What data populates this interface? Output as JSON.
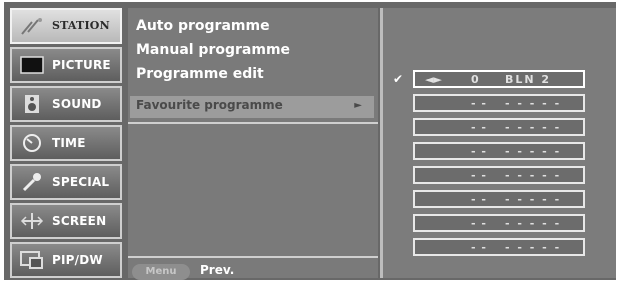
{
  "menu": {
    "items": [
      {
        "label": "STATION",
        "icon": "station-icon",
        "active": true
      },
      {
        "label": "PICTURE",
        "icon": "picture-icon"
      },
      {
        "label": "SOUND",
        "icon": "sound-icon"
      },
      {
        "label": "TIME",
        "icon": "time-icon"
      },
      {
        "label": "SPECIAL",
        "icon": "special-icon"
      },
      {
        "label": "SCREEN",
        "icon": "screen-icon"
      },
      {
        "label": "PIP/DW",
        "icon": "pip-icon"
      }
    ]
  },
  "submenu": {
    "items": [
      {
        "label": "Auto programme"
      },
      {
        "label": "Manual programme"
      },
      {
        "label": "Programme edit"
      },
      {
        "label": "Favourite programme",
        "selected": true,
        "arrow": "►"
      }
    ],
    "menu_button": "Menu",
    "prev_label": "Prev."
  },
  "favourites": {
    "check": "✔",
    "slots": [
      {
        "arrows": "◄►",
        "number": "0",
        "name": "BLN 2",
        "selected": true
      },
      {
        "arrows": "",
        "number": "- -",
        "name": "- - - - -"
      },
      {
        "arrows": "",
        "number": "- -",
        "name": "- - - - -"
      },
      {
        "arrows": "",
        "number": "- -",
        "name": "- - - - -"
      },
      {
        "arrows": "",
        "number": "- -",
        "name": "- - - - -"
      },
      {
        "arrows": "",
        "number": "- -",
        "name": "- - - - -"
      },
      {
        "arrows": "",
        "number": "- -",
        "name": "- - - - -"
      },
      {
        "arrows": "",
        "number": "- -",
        "name": "- - - - -"
      }
    ]
  }
}
